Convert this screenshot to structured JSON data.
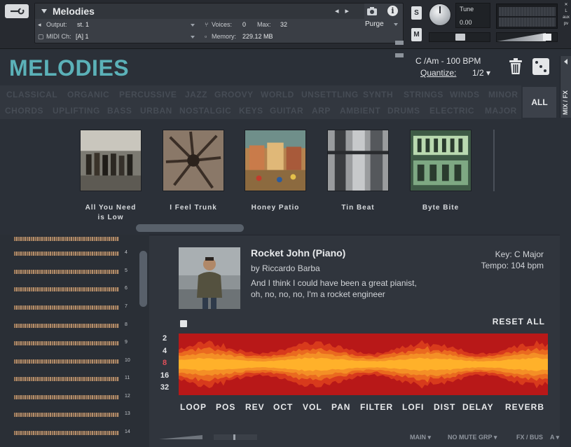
{
  "kontakt": {
    "instrument_name": "Melodies",
    "output_label": "Output:",
    "output_value": "st. 1",
    "voices_label": "Voices:",
    "voices_value": "0",
    "max_label": "Max:",
    "max_value": "32",
    "purge_label": "Purge",
    "midi_label": "MIDI Ch:",
    "midi_value": "[A]  1",
    "memory_label": "Memory:",
    "memory_value": "229.12 MB",
    "solo_label": "S",
    "mute_label": "M",
    "tune_label": "Tune",
    "tune_value": "0.00",
    "side_labels": [
      "✕",
      "L",
      "aux",
      "pv"
    ]
  },
  "header": {
    "title": "MELODIES",
    "key_bpm": "C /Am  - 100 BPM",
    "quantize_label": "Quantize:",
    "quantize_value": "1/2 ▾",
    "mix_fx": "MIX / FX"
  },
  "tags": {
    "row1": [
      "CLASSICAL",
      "ORGANIC",
      "PERCUSSIVE",
      "JAZZ",
      "GROOVY",
      "WORLD",
      "UNSETTLING",
      "SYNTH",
      "STRINGS",
      "WINDS",
      "MINOR"
    ],
    "row2": [
      "CHORDS",
      "UPLIFTING",
      "BASS",
      "URBAN",
      "NOSTALGIC",
      "KEYS",
      "GUITAR",
      "ARP",
      "AMBIENT",
      "DRUMS",
      "ELECTRIC",
      "MAJOR"
    ],
    "all_label": "ALL"
  },
  "presets": [
    {
      "line1": "All You Need",
      "line2": "is Low"
    },
    {
      "line1": "I Feel Trunk",
      "line2": ""
    },
    {
      "line1": "Honey Patio",
      "line2": ""
    },
    {
      "line1": "Tin Beat",
      "line2": ""
    },
    {
      "line1": "Byte Bite",
      "line2": ""
    }
  ],
  "list_numbers": [
    "4",
    "5",
    "6",
    "7",
    "8",
    "9",
    "10",
    "11",
    "12",
    "13",
    "14"
  ],
  "detail": {
    "title": "Rocket John (Piano)",
    "artist": "by Riccardo Barba",
    "desc_line1": "And I think I could have been a great pianist,",
    "desc_line2": "oh, no, no, no, I'm a rocket engineer",
    "key": "Key: C Major",
    "tempo": "Tempo: 104 bpm",
    "reset_all": "RESET ALL",
    "divisions": [
      "2",
      "4",
      "8",
      "16",
      "32"
    ],
    "selected_division": "8"
  },
  "fx_tabs": [
    "LOOP",
    "POS",
    "REV",
    "OCT",
    "VOL",
    "PAN",
    "FILTER",
    "LOFI",
    "DIST",
    "DELAY",
    "REVERB"
  ],
  "bottom": {
    "main": "MAIN ▾",
    "mute_grp": "NO MUTE GRP ▾",
    "fx_bus": "FX / BUS",
    "a": "A ▾"
  },
  "colors": {
    "accent": "#5bb1b8",
    "selected_division": "#e0505a",
    "wave_outer": "#c81e1e",
    "wave_inner": "#ffb12a"
  }
}
